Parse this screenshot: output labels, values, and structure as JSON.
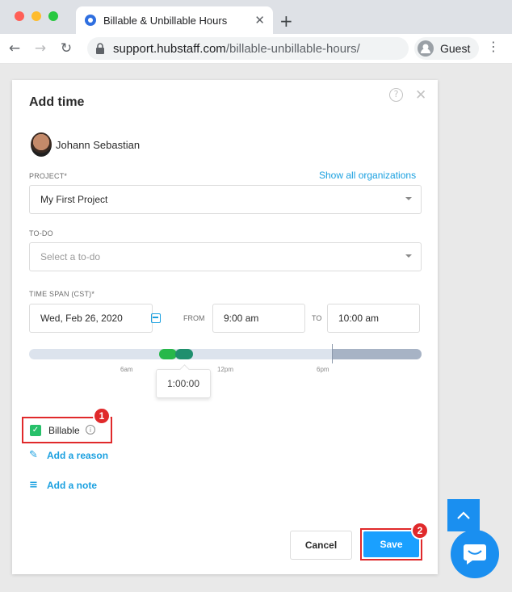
{
  "browser": {
    "tab_title": "Billable & Unbillable Hours",
    "url_host": "support.hubstaff.com",
    "url_path": "/billable-unbillable-hours/",
    "profile_label": "Guest",
    "new_tab_glyph": "+",
    "tab_close_glyph": "✕",
    "back_glyph": "←",
    "forward_glyph": "→",
    "reload_glyph": "↻",
    "menu_glyph": "⋮",
    "window_dots": [
      "#ff5f57",
      "#febc2e",
      "#28c840"
    ]
  },
  "modal": {
    "title": "Add time",
    "help_glyph": "?",
    "close_glyph": "✕",
    "user_name": "Johann Sebastian",
    "project_label": "PROJECT*",
    "show_all_link": "Show all organizations",
    "project_value": "My First Project",
    "todo_label": "TO-DO",
    "todo_placeholder": "Select a to-do",
    "timespan_label": "TIME SPAN (CST)*",
    "date_value": "Wed, Feb 26, 2020",
    "from_label": "FROM",
    "from_value": "9:00 am",
    "to_label": "TO",
    "to_value": "10:00 am",
    "ticks": [
      "6am",
      "12pm",
      "6pm"
    ],
    "duration": "1:00:00",
    "billable_label": "Billable",
    "billable_checked": true,
    "add_reason": "Add a reason",
    "add_note": "Add a note",
    "cancel_label": "Cancel",
    "save_label": "Save"
  },
  "annotations": {
    "badge_1": "1",
    "badge_2": "2"
  },
  "colors": {
    "accent": "#1aa0e0",
    "highlight": "#e0292b",
    "billable_check": "#27c06a"
  }
}
